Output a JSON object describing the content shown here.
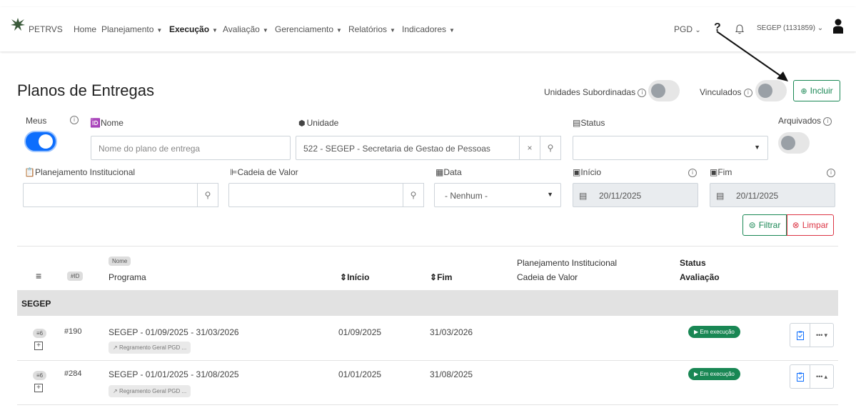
{
  "navbar": {
    "brand": "PETRVS",
    "items": [
      {
        "label": "Home",
        "caret": false,
        "bold": false
      },
      {
        "label": "Planejamento",
        "caret": true,
        "bold": false
      },
      {
        "label": "Execução",
        "caret": true,
        "bold": true
      },
      {
        "label": "Avaliação",
        "caret": true,
        "bold": false
      },
      {
        "label": "Gerenciamento",
        "caret": true,
        "bold": false
      },
      {
        "label": "Relatórios",
        "caret": true,
        "bold": false
      },
      {
        "label": "Indicadores",
        "caret": true,
        "bold": false
      }
    ],
    "module": "PGD",
    "help": "?",
    "user": "SEGEP (1131859)"
  },
  "page": {
    "title": "Planos de Entregas",
    "unidades_subordinadas": "Unidades Subordinadas",
    "vinculados": "Vinculados",
    "incluir": "Incluir"
  },
  "filters": {
    "meus": "Meus",
    "nome_label": "Nome",
    "nome_placeholder": "Nome do plano de entrega",
    "unidade_label": "Unidade",
    "unidade_value": "522 - SEGEP - Secretaria de Gestao de Pessoas",
    "status_label": "Status",
    "arquivados": "Arquivados",
    "planejamento_label": "Planejamento Institucional",
    "cadeia_label": "Cadeia de Valor",
    "data_label": "Data",
    "data_value": "- Nenhum -",
    "inicio_label": "Início",
    "inicio_value": "20/11/2025",
    "fim_label": "Fim",
    "fim_value": "20/11/2025",
    "filtrar": "Filtrar",
    "limpar": "Limpar"
  },
  "table": {
    "headers": {
      "id_badge": "#ID",
      "nome_badge": "Nome",
      "programa": "Programa",
      "inicio": "Início",
      "fim": "Fim",
      "planejamento": "Planejamento Institucional",
      "cadeia": "Cadeia de Valor",
      "status": "Status",
      "avaliacao": "Avaliação"
    },
    "group": "SEGEP",
    "rows": [
      {
        "count": "6",
        "id": "#190",
        "nome": "SEGEP - 01/09/2025 - 31/03/2026",
        "programa": "Regramento Geral PGD ...",
        "inicio": "01/09/2025",
        "fim": "31/03/2026",
        "status": "Em execução",
        "caret": "▾"
      },
      {
        "count": "6",
        "id": "#284",
        "nome": "SEGEP - 01/01/2025 - 31/08/2025",
        "programa": "Regramento Geral PGD ...",
        "inicio": "01/01/2025",
        "fim": "31/08/2025",
        "status": "Em execução",
        "caret": "▴"
      }
    ]
  },
  "colors": {
    "primary": "#0d6efd",
    "success": "#198754",
    "danger": "#dc3545"
  }
}
